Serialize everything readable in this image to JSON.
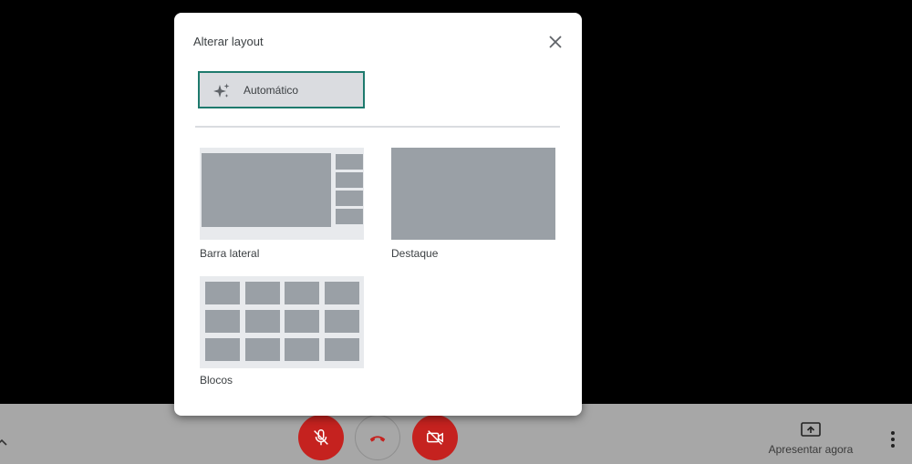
{
  "dialog": {
    "title": "Alterar layout",
    "close_icon": "close-icon",
    "auto_option": {
      "label": "Automático",
      "icon": "sparkle-icon",
      "selected": true
    },
    "options": [
      {
        "label": "Barra lateral"
      },
      {
        "label": "Destaque"
      },
      {
        "label": "Blocos"
      }
    ]
  },
  "toolbar": {
    "present_label": "Apresentar agora",
    "present_icon": "present-screen-icon",
    "mic_icon": "mic-off-icon",
    "hangup_icon": "hangup-icon",
    "camera_icon": "camera-off-icon",
    "more_icon": "more-vert-icon",
    "expand_icon": "chevron-up-icon"
  },
  "colors": {
    "accent_border": "#1e7a6d",
    "danger": "#c5221f",
    "toolbar_bg": "#a7a7a7",
    "thumb_block": "#9aa0a6"
  }
}
